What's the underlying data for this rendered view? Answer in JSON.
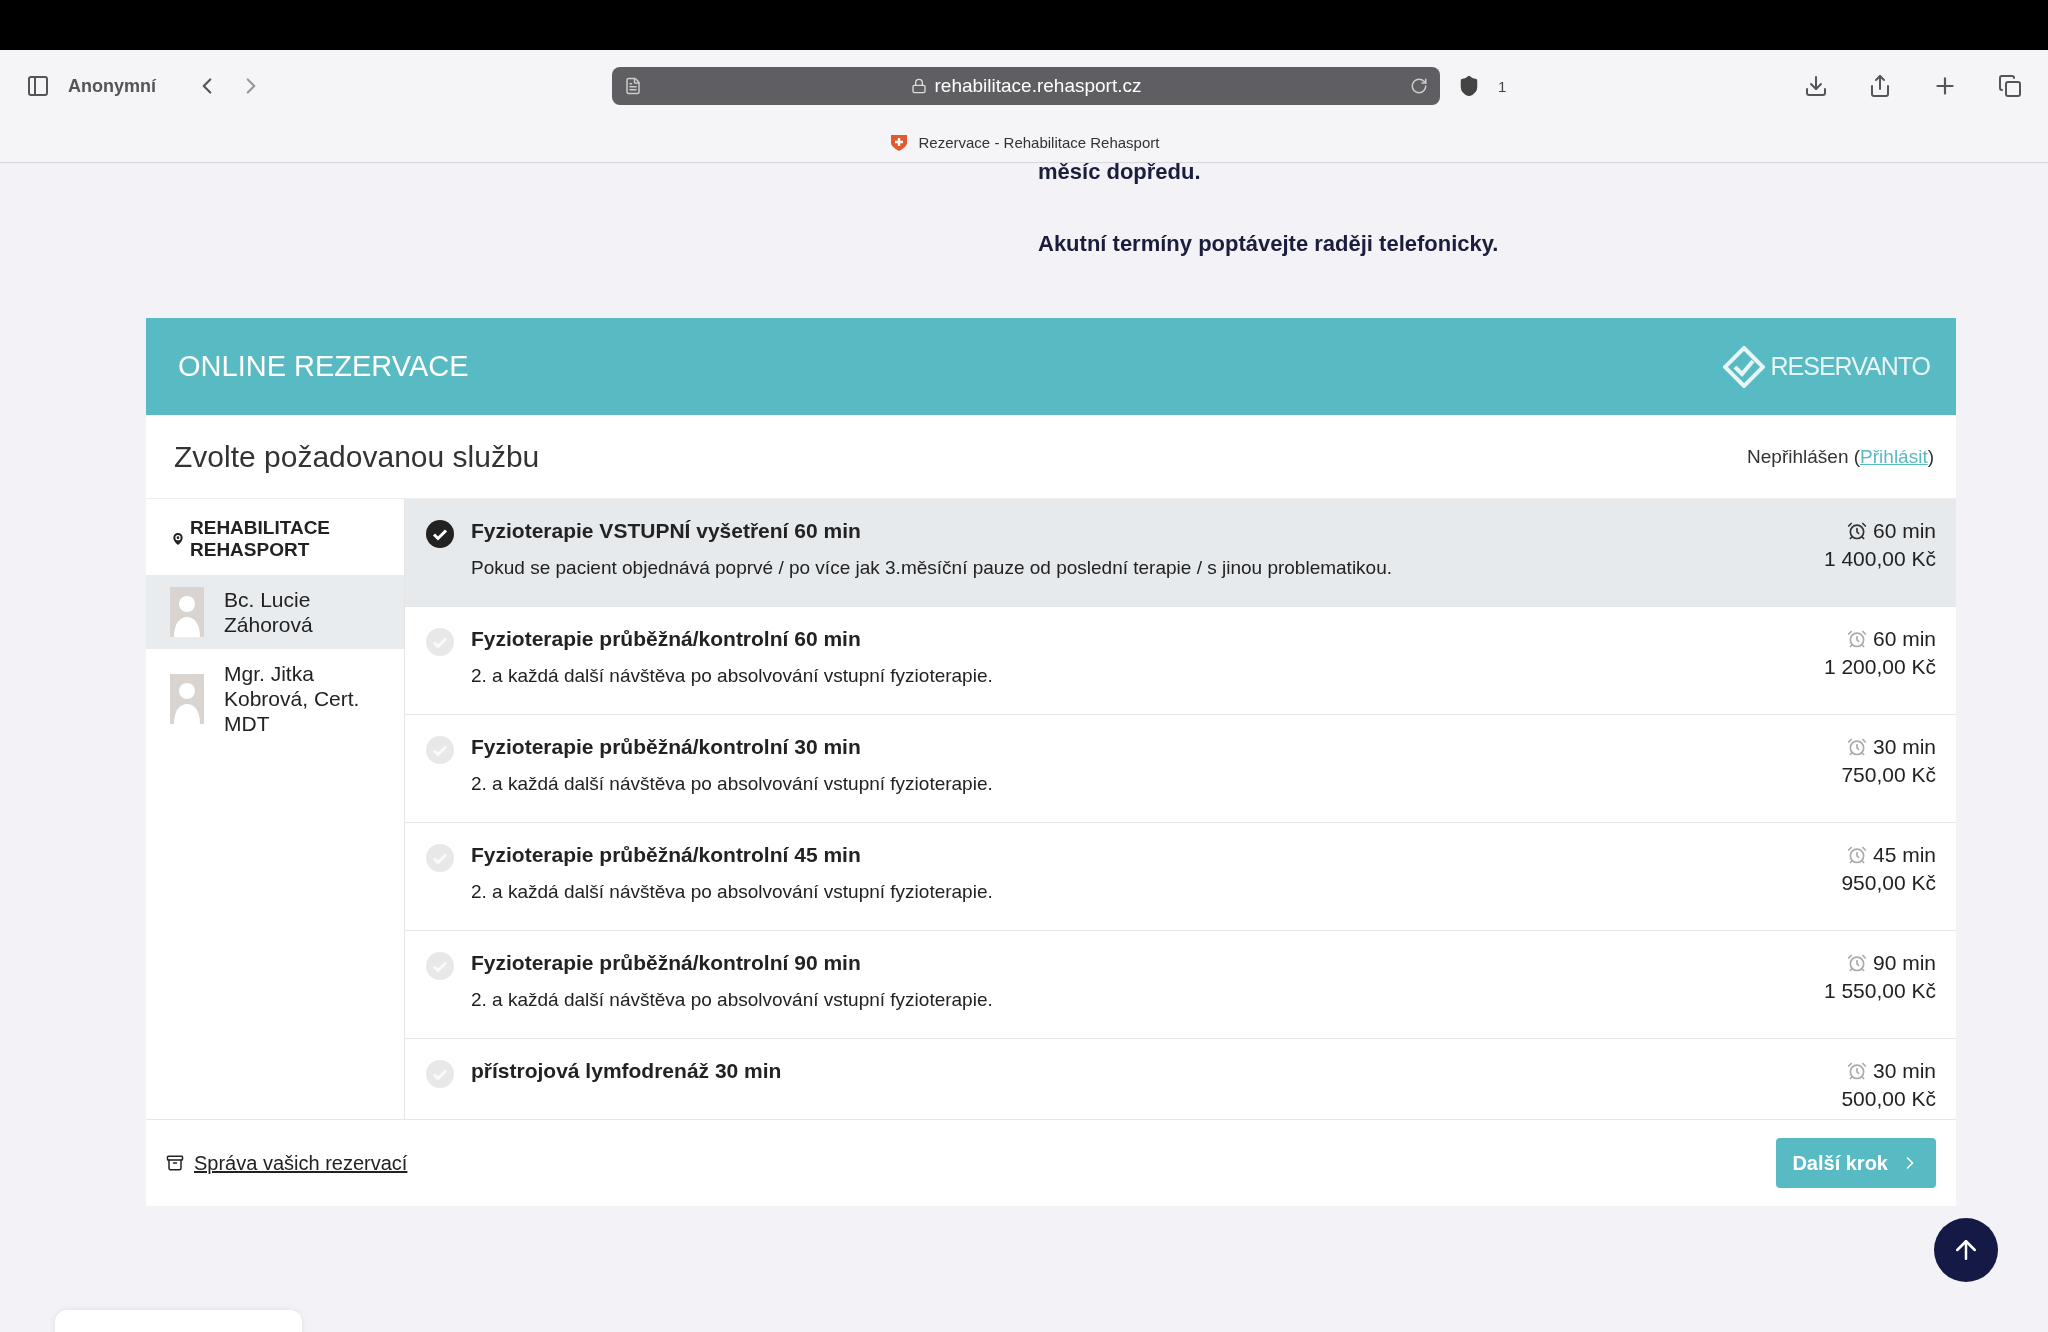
{
  "browser": {
    "profile": "Anonymní",
    "url": "rehabilitace.rehasport.cz",
    "shield_count": "1",
    "tab_title": "Rezervace - Rehabilitace Rehasport"
  },
  "intro": {
    "cut_line": "měsíc dopředu.",
    "note": "Akutní termíny poptávejte raději telefonicky."
  },
  "widget": {
    "title": "ONLINE REZERVACE",
    "logo": "RESERVANTO",
    "step_title": "Zvolte požadovanou službu",
    "login_status": "Nepřihlášen",
    "login_open": "(",
    "login_link": "Přihlásit",
    "login_close": ")"
  },
  "sidebar": {
    "location": "REHABILITACE REHASPORT",
    "staff": [
      {
        "name": "Bc. Lucie Záhorová",
        "selected": true
      },
      {
        "name": "Mgr. Jitka Kobrová, Cert. MDT",
        "selected": false
      }
    ]
  },
  "services": [
    {
      "title": "Fyzioterapie VSTUPNÍ vyšetření 60 min",
      "description": "Pokud se pacient objednává poprvé / po více jak 3.měsíční pauze od poslední terapie / s jinou problematikou.",
      "duration": "60 min",
      "price": "1 400,00 Kč",
      "selected": true
    },
    {
      "title": "Fyzioterapie průběžná/kontrolní 60 min",
      "description": "2. a každá další návštěva po absolvování vstupní fyzioterapie.",
      "duration": "60 min",
      "price": "1 200,00 Kč",
      "selected": false
    },
    {
      "title": "Fyzioterapie průběžná/kontrolní 30 min",
      "description": "2. a každá další návštěva po absolvování vstupní fyzioterapie.",
      "duration": "30 min",
      "price": "750,00 Kč",
      "selected": false
    },
    {
      "title": "Fyzioterapie průběžná/kontrolní 45 min",
      "description": "2. a každá další návštěva po absolvování vstupní fyzioterapie.",
      "duration": "45 min",
      "price": "950,00 Kč",
      "selected": false
    },
    {
      "title": "Fyzioterapie průběžná/kontrolní 90 min",
      "description": "2. a každá další návštěva po absolvování vstupní fyzioterapie.",
      "duration": "90 min",
      "price": "1 550,00 Kč",
      "selected": false
    },
    {
      "title": "přístrojová lymfodrenáž 30 min",
      "duration": "30 min",
      "price": "500,00 Kč",
      "selected": false
    }
  ],
  "footer": {
    "manage_link": "Správa vašich rezervací",
    "next_button": "Další krok"
  }
}
